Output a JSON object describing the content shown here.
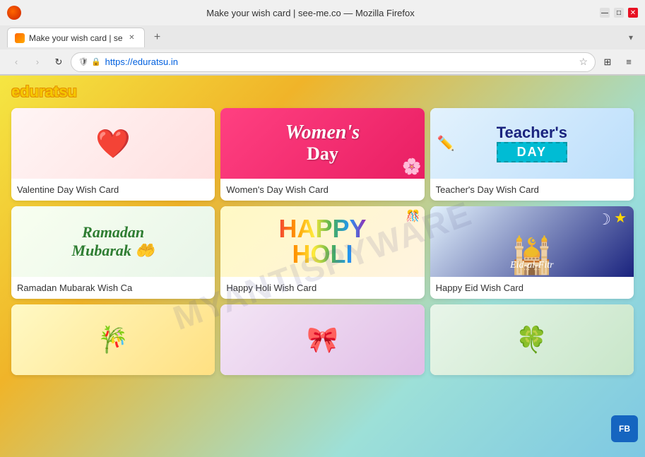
{
  "browser": {
    "title": "Make your wish card | see-me.co — Mozilla Firefox",
    "tab_label": "Make your wish card | se",
    "url": "https://eduratsu.in",
    "new_tab_symbol": "+",
    "nav": {
      "back": "‹",
      "forward": "›",
      "refresh": "↻",
      "home": "",
      "lock": "🔒",
      "shield": "🛡"
    }
  },
  "page": {
    "logo": "eduratsu",
    "watermark": "MYANTISPYWARE",
    "cards": [
      {
        "label": "Valentine Day Wish Card",
        "type": "valentine"
      },
      {
        "label": "Women's Day Wish Card",
        "type": "womens"
      },
      {
        "label": "Teacher's Day Wish Card",
        "type": "teachers"
      },
      {
        "label": "Ramadan Mubarak Wish Ca",
        "type": "ramadan"
      },
      {
        "label": "Happy Holi Wish Card",
        "type": "holi"
      },
      {
        "label": "Happy Eid Wish Card",
        "type": "eid"
      },
      {
        "label": "",
        "type": "partial1"
      },
      {
        "label": "",
        "type": "partial2"
      },
      {
        "label": "",
        "type": "partial3"
      }
    ],
    "feedback_label": "FB"
  }
}
